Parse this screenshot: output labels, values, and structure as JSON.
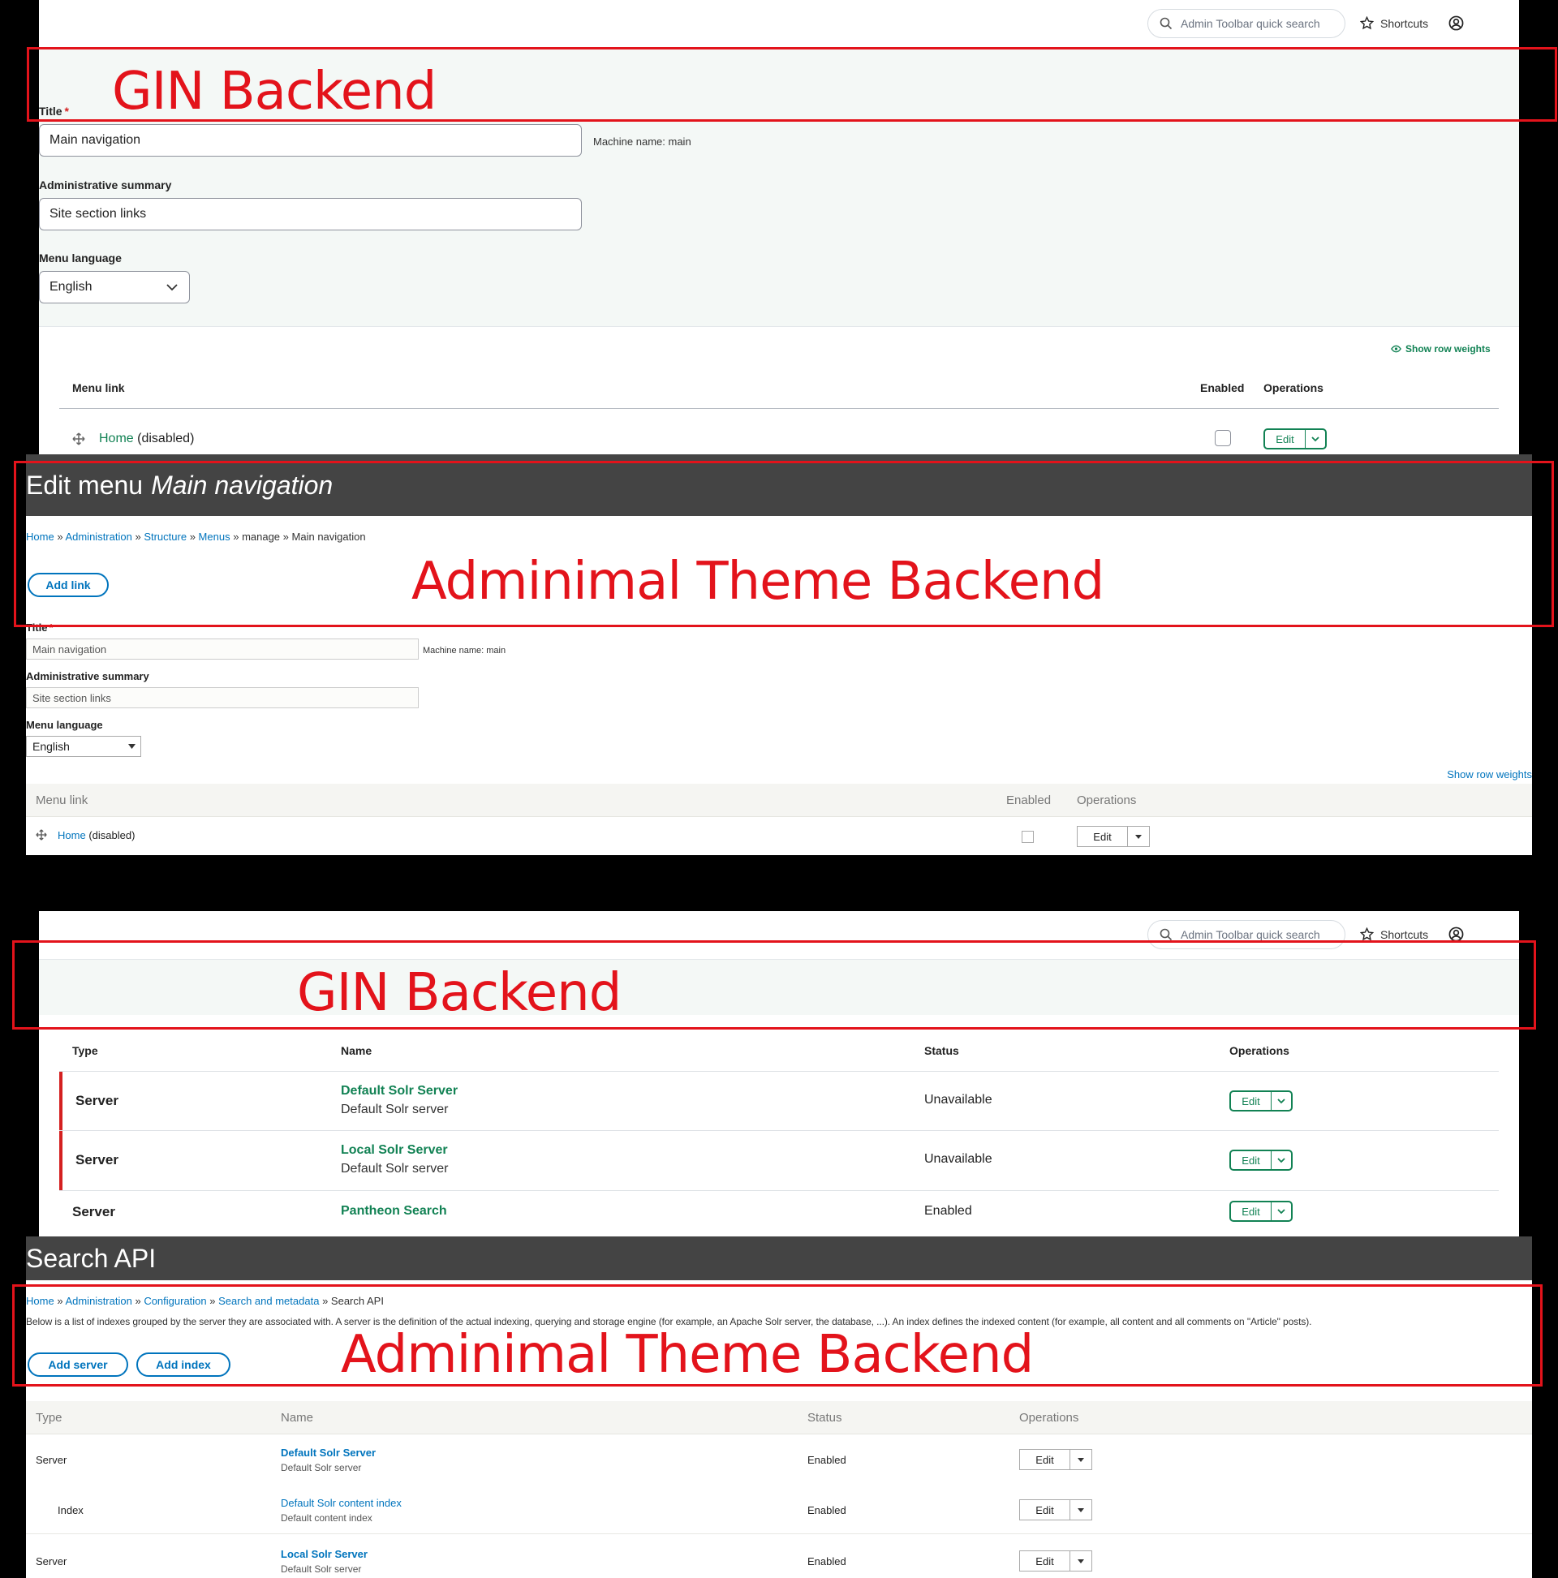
{
  "annotations": {
    "gin_label": "GIN Backend",
    "adminimal_label": "Adminimal Theme Backend",
    "color": "#e3131b"
  },
  "gin_toolbar": {
    "search_placeholder": "Admin Toolbar quick search",
    "shortcuts": "Shortcuts",
    "icons": [
      "search-icon",
      "star-icon",
      "user-icon"
    ]
  },
  "menu_gin": {
    "title_label": "Title",
    "required_mark": "*",
    "title_value": "Main navigation",
    "machine_name": "Machine name: main",
    "summary_label": "Administrative summary",
    "summary_value": "Site section links",
    "language_label": "Menu language",
    "language_value": "English",
    "show_row_weights": "Show row weights",
    "col_menu_link": "Menu link",
    "col_enabled": "Enabled",
    "col_operations": "Operations",
    "row_link": "Home",
    "row_status": "(disabled)",
    "row_enabled": false,
    "edit_label": "Edit",
    "accent": "#128254"
  },
  "menu_adminimal": {
    "page_title_prefix": "Edit menu",
    "page_title_menu": "Main navigation",
    "breadcrumb": [
      "Home",
      "Administration",
      "Structure",
      "Menus",
      "manage",
      "Main navigation"
    ],
    "breadcrumb_sep": "»",
    "add_link": "Add link",
    "title_label": "Title",
    "required_mark": "*",
    "title_value": "Main navigation",
    "machine_name": "Machine name: main",
    "summary_label": "Administrative summary",
    "summary_value": "Site section links",
    "language_label": "Menu language",
    "language_value": "English",
    "show_row_weights": "Show row weights",
    "col_menu_link": "Menu link",
    "col_enabled": "Enabled",
    "col_operations": "Operations",
    "row_link": "Home",
    "row_status": "(disabled)",
    "row_enabled": false,
    "edit_label": "Edit",
    "accent": "#0074bd"
  },
  "search_gin": {
    "col_type": "Type",
    "col_name": "Name",
    "col_status": "Status",
    "col_operations": "Operations",
    "edit_label": "Edit",
    "rows": [
      {
        "type": "Server",
        "name": "Default Solr Server",
        "desc": "Default Solr server",
        "status": "Unavailable"
      },
      {
        "type": "Server",
        "name": "Local Solr Server",
        "desc": "Default Solr server",
        "status": "Unavailable"
      },
      {
        "type": "Server",
        "name": "Pantheon Search",
        "desc": "",
        "status": "Enabled"
      }
    ],
    "error_color": "#d42020"
  },
  "search_adminimal": {
    "page_title": "Search API",
    "breadcrumb": [
      "Home",
      "Administration",
      "Configuration",
      "Search and metadata",
      "Search API"
    ],
    "breadcrumb_sep": "»",
    "description": "Below is a list of indexes grouped by the server they are associated with. A server is the definition of the actual indexing, querying and storage engine (for example, an Apache Solr server, the database, ...). An index defines the indexed content (for example, all content and all comments on \"Article\" posts).",
    "add_server": "Add server",
    "add_index": "Add index",
    "col_type": "Type",
    "col_name": "Name",
    "col_status": "Status",
    "col_operations": "Operations",
    "edit_label": "Edit",
    "rows": [
      {
        "type": "Server",
        "name": "Default Solr Server",
        "desc": "Default Solr server",
        "status": "Enabled"
      },
      {
        "type": "Index",
        "name": "Default Solr content index",
        "desc": "Default content index",
        "status": "Enabled"
      },
      {
        "type": "Server",
        "name": "Local Solr Server",
        "desc": "Default Solr server",
        "status": "Enabled"
      }
    ]
  }
}
